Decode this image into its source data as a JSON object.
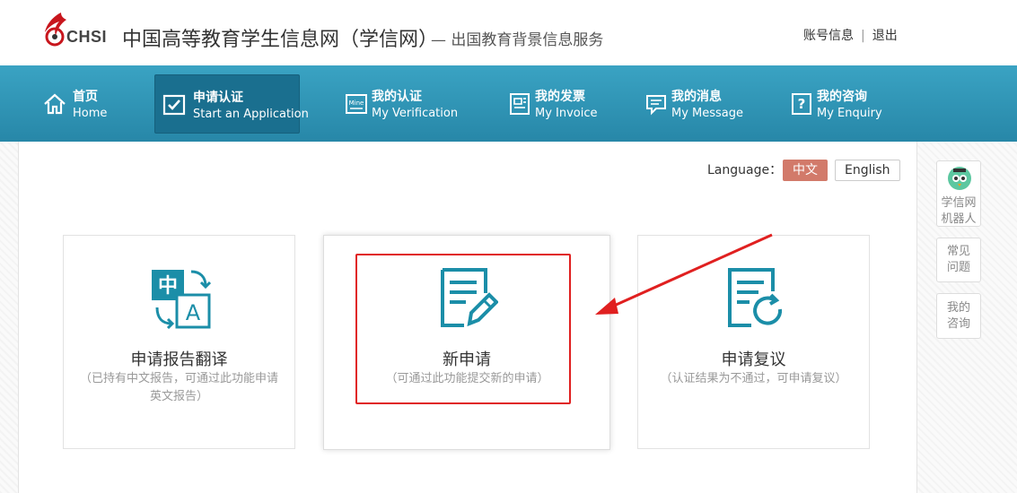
{
  "header": {
    "logo_text": "CHSI",
    "site_title": "中国高等教育学生信息网（学信网）",
    "site_sub": "— 出国教育背景信息服务",
    "links": {
      "account": "账号信息",
      "logout": "退出"
    }
  },
  "nav": [
    {
      "zh": "首页",
      "en": "Home",
      "icon": "home-icon"
    },
    {
      "zh": "申请认证",
      "en": "Start an Application",
      "icon": "check-square-icon",
      "active": true
    },
    {
      "zh": "我的认证",
      "en": "My Verification",
      "icon": "mine-icon",
      "icon_label": "Mine"
    },
    {
      "zh": "我的发票",
      "en": "My Invoice",
      "icon": "invoice-icon"
    },
    {
      "zh": "我的消息",
      "en": "My Message",
      "icon": "message-icon"
    },
    {
      "zh": "我的咨询",
      "en": "My Enquiry",
      "icon": "question-icon"
    }
  ],
  "language": {
    "label": "Language：",
    "zh": "中文",
    "en": "English",
    "selected": "zh"
  },
  "cards": [
    {
      "title": "申请报告翻译",
      "desc": "（已持有中文报告，可通过此功能申请英文报告）",
      "icon": "translate-icon",
      "icon_zh": "中",
      "icon_en": "A"
    },
    {
      "title": "新申请",
      "desc": "（可通过此功能提交新的申请）",
      "icon": "new-application-icon"
    },
    {
      "title": "申请复议",
      "desc": "（认证结果为不通过，可申请复议）",
      "icon": "reconsider-icon"
    }
  ],
  "side": {
    "robot": "学信网机器人",
    "faq": "常见问题",
    "my_enquiry": "我的咨询"
  },
  "colors": {
    "nav_top": "#3aa3c3",
    "nav_bottom": "#2787a8",
    "accent": "#1b8ea8",
    "lang_active": "#d27a6a",
    "highlight": "#e02020"
  }
}
